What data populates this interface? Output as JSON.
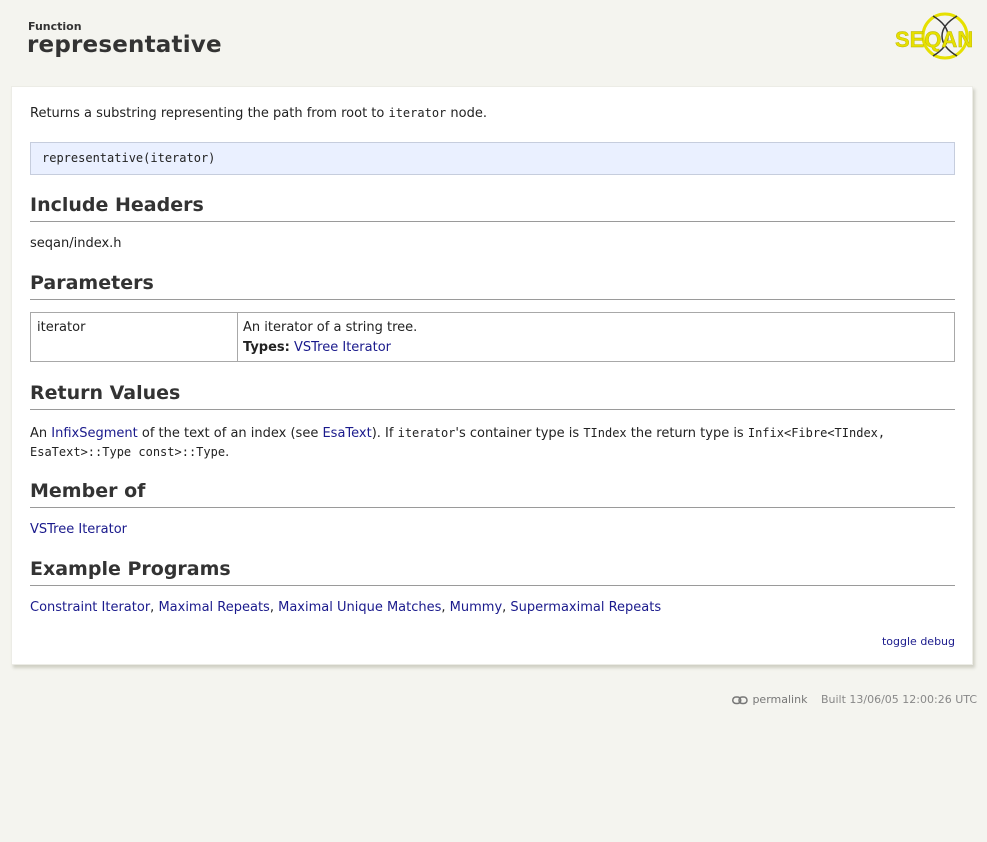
{
  "header": {
    "kind": "Function",
    "title": "representative",
    "logo_text": "SEQAN"
  },
  "summary": {
    "prefix": "Returns a substring representing the path from root to ",
    "code": "iterator",
    "suffix": " node."
  },
  "signature": "representative(iterator)",
  "sections": {
    "include_headers": "Include Headers",
    "parameters": "Parameters",
    "return_values": "Return Values",
    "member_of": "Member of",
    "example_programs": "Example Programs"
  },
  "include_header": "seqan/index.h",
  "parameters": [
    {
      "name": "iterator",
      "description": "An iterator of a string tree.",
      "types_label": "Types:",
      "types_link": "VSTree Iterator"
    }
  ],
  "return_value": {
    "p1": "An ",
    "link1": "InfixSegment",
    "p2": " of the text of an index (see ",
    "link2": "EsaText",
    "p3": "). If ",
    "code1": "iterator",
    "p4": "'s container type is ",
    "code2": "TIndex",
    "p5": " the return type is ",
    "code3": "Infix<Fibre<TIndex,",
    "line2_code": "EsaText>::Type const>::Type",
    "line2_end": "."
  },
  "member_of": "VSTree Iterator",
  "example_programs": [
    "Constraint Iterator",
    "Maximal Repeats",
    "Maximal Unique Matches",
    "Mummy",
    "Supermaximal Repeats"
  ],
  "example_separator": ", ",
  "toggle_debug": "toggle debug",
  "footer": {
    "permalink": "permalink",
    "built": "Built 13/06/05 12:00:26 UTC"
  },
  "colors": {
    "link": "#1a1a8c",
    "signature_bg": "#eaf0ff",
    "page_bg": "#f4f4ef",
    "logo_yellow": "#e6e000"
  },
  "icons": [
    "seqan-logo",
    "chain-link-icon"
  ]
}
